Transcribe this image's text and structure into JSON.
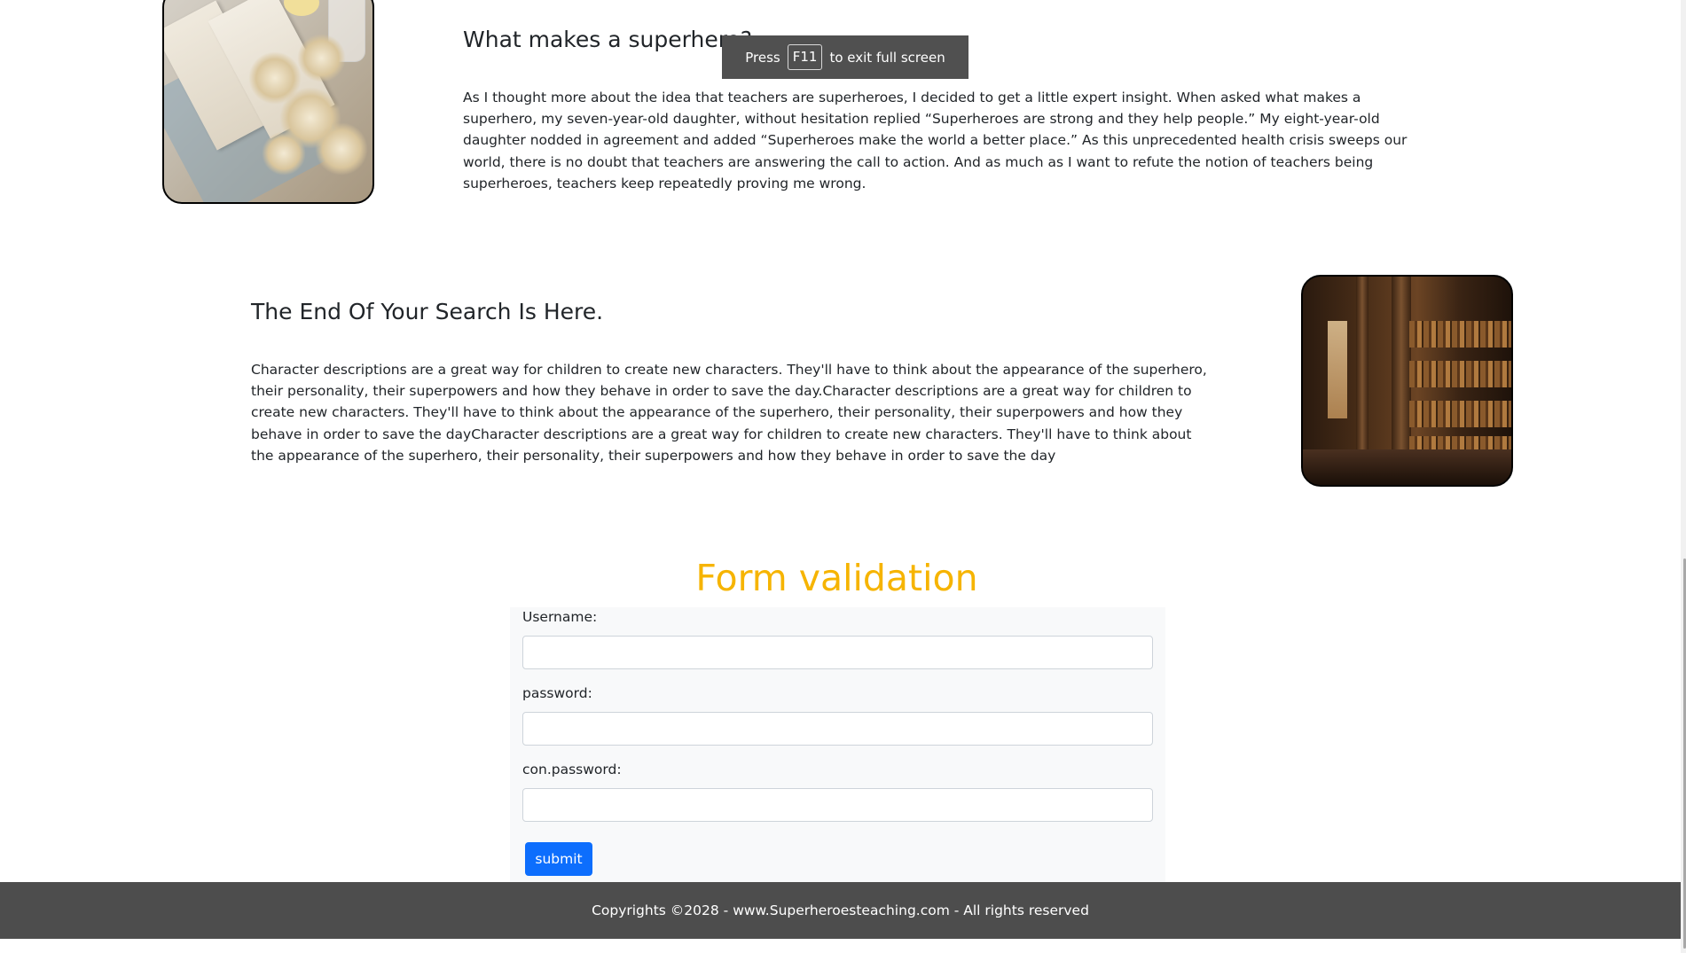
{
  "section1": {
    "heading": "What makes a superhero?",
    "paragraph": "As I thought more about the idea that teachers are superheroes, I decided to get a little expert insight. When asked what makes a superhero, my seven-year-old daughter, without hesitation replied “Superheroes are strong and they help people.” My eight-year-old daughter nodded in agreement and added “Superheroes make the world a better place.” As this unprecedented health crisis sweeps our world, there is no doubt that teachers are answering the call to action. And as much as I want to refute the notion of teachers being superheroes, teachers keep repeatedly proving me wrong."
  },
  "fullscreen_notice": {
    "prefix": "Press",
    "key": "F11",
    "suffix": "to exit full screen"
  },
  "section2": {
    "heading": "The End Of Your Search Is Here.",
    "paragraph": "Character descriptions are a great way for children to create new characters. They'll have to think about the appearance of the superhero, their personality, their superpowers and how they behave in order to save the day.Character descriptions are a great way for children to create new characters. They'll have to think about the appearance of the superhero, their personality, their superpowers and how they behave in order to save the dayCharacter descriptions are a great way for children to create new characters. They'll have to think about the appearance of the superhero, their personality, their superpowers and how they behave in order to save the day"
  },
  "form": {
    "title": "Form validation",
    "username_label": "Username:",
    "username_value": "",
    "password_label": "password:",
    "password_value": "",
    "confirm_label": "con.password:",
    "confirm_value": "",
    "submit_label": "submit"
  },
  "footer": {
    "text": "Copyrights ©2028 - www.Superheroesteaching.com - All rights reserved"
  },
  "colors": {
    "form_title": "#f6b400",
    "submit_button": "#0d6efd",
    "footer_bg": "#4d4d4d",
    "toast_bg": "#505050"
  }
}
